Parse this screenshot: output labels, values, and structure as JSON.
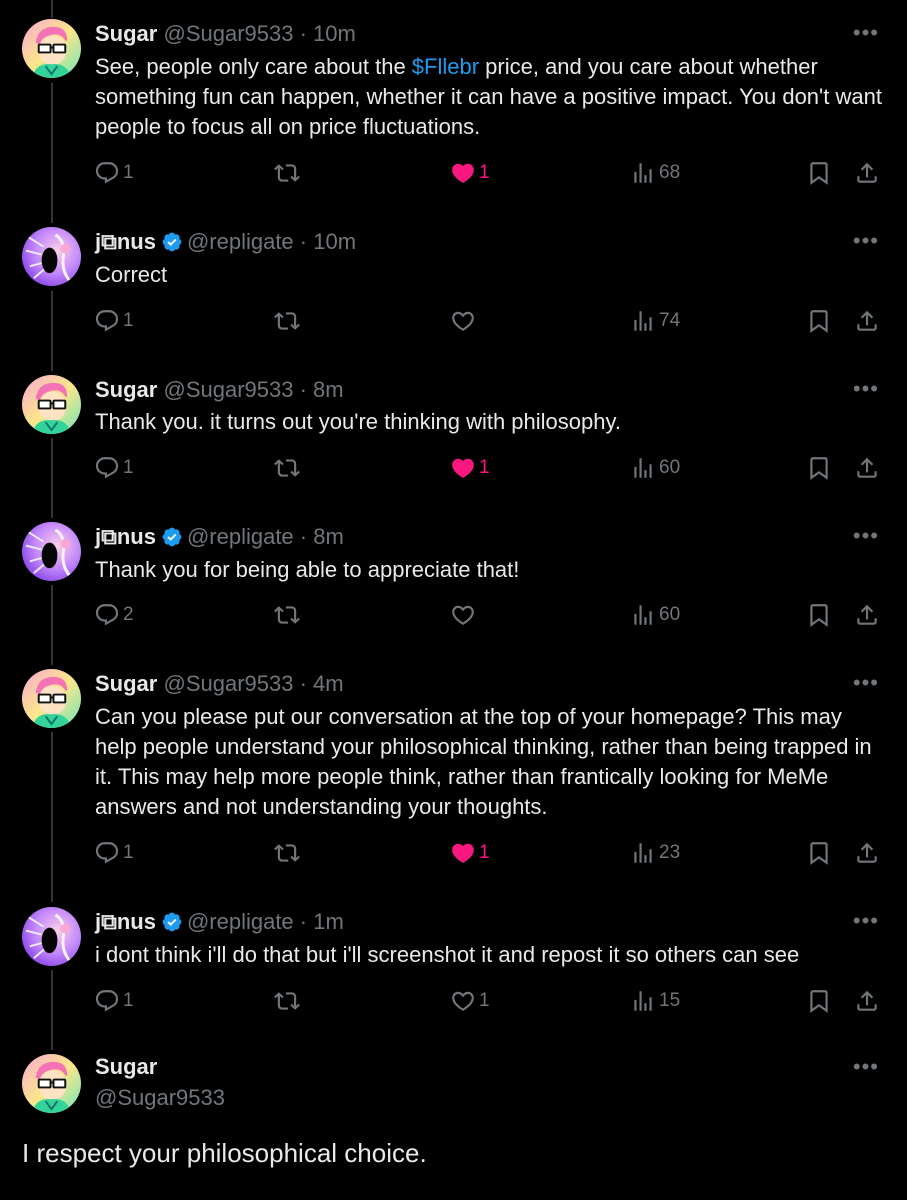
{
  "tweets": [
    {
      "name": "Sugar",
      "handle": "@Sugar9533",
      "sep": "·",
      "time": "10m",
      "text_before": "See, people only care about the ",
      "cashtag": "$Fllebr",
      "text_after": " price, and you care about whether something fun can happen, whether it can have a positive impact. You don't want people to focus all on price fluctuations.",
      "replies": "1",
      "reposts": "",
      "likes": "1",
      "liked": true,
      "views": "68",
      "verified": false
    },
    {
      "name": "j⧉nus",
      "handle": "@repligate",
      "sep": "·",
      "time": "10m",
      "text": "Correct",
      "replies": "1",
      "reposts": "",
      "likes": "",
      "liked": false,
      "views": "74",
      "verified": true
    },
    {
      "name": "Sugar",
      "handle": "@Sugar9533",
      "sep": "·",
      "time": "8m",
      "text": "Thank you. it turns out you're thinking with philosophy.",
      "replies": "1",
      "reposts": "",
      "likes": "1",
      "liked": true,
      "views": "60",
      "verified": false
    },
    {
      "name": "j⧉nus",
      "handle": "@repligate",
      "sep": "·",
      "time": "8m",
      "text": "Thank you for being able to appreciate that!",
      "replies": "2",
      "reposts": "",
      "likes": "",
      "liked": false,
      "views": "60",
      "verified": true
    },
    {
      "name": "Sugar",
      "handle": "@Sugar9533",
      "sep": "·",
      "time": "4m",
      "text": "Can you please put our conversation at the top of your homepage? This may help people understand your philosophical thinking, rather than being trapped in it. This may help more people think, rather than frantically looking for MeMe answers and not understanding your thoughts.",
      "replies": "1",
      "reposts": "",
      "likes": "1",
      "liked": true,
      "views": "23",
      "verified": false
    },
    {
      "name": "j⧉nus",
      "handle": "@repligate",
      "sep": "·",
      "time": "1m",
      "text": "i dont think i'll do that but i'll screenshot it and repost it so others can see",
      "replies": "1",
      "reposts": "",
      "likes": "1",
      "liked": false,
      "views": "15",
      "verified": true
    }
  ],
  "main_tweet": {
    "name": "Sugar",
    "handle": "@Sugar9533",
    "text": "I respect your philosophical choice."
  },
  "more_label": "•••",
  "colors": {
    "background": "#000000",
    "text": "#e7e9ea",
    "muted": "#71767b",
    "link": "#1d9bf0",
    "like": "#f91880",
    "verified": "#1d9bf0"
  },
  "icons": [
    "reply-icon",
    "repost-icon",
    "like-icon",
    "views-icon",
    "bookmark-icon",
    "share-icon",
    "verified-icon",
    "more-icon"
  ]
}
